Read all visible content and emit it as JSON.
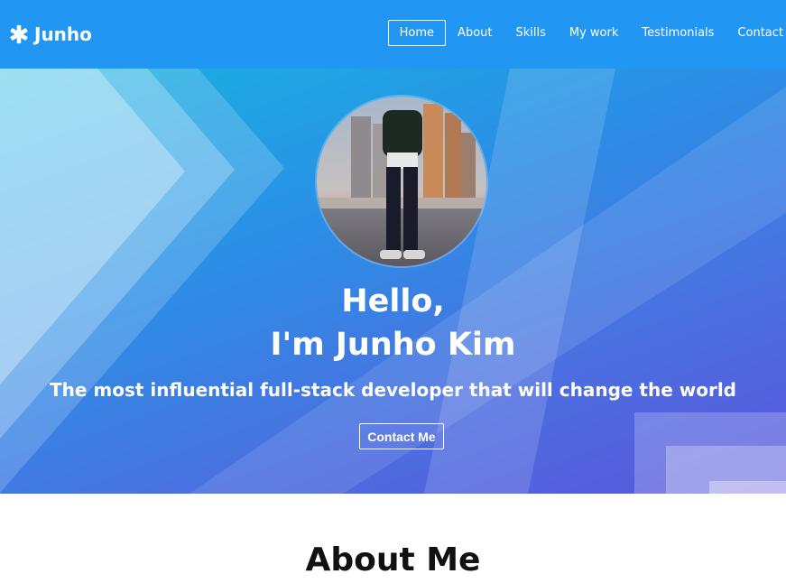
{
  "nav": {
    "logo_text": "Junho",
    "logo_icon": "asterisk-icon",
    "items": [
      "Home",
      "About",
      "Skills",
      "My work",
      "Testimonials",
      "Contact"
    ],
    "active_index": 0
  },
  "hero": {
    "greeting_line1": "Hello,",
    "greeting_line2": "I'm Junho Kim",
    "tagline": "The most influential full-stack developer that will change the world",
    "contact_label": "Contact Me"
  },
  "about": {
    "title": "About Me"
  },
  "colors": {
    "nav_bg": "#2196f3",
    "hero_start": "#16b3e0",
    "hero_end": "#5a55dc"
  }
}
